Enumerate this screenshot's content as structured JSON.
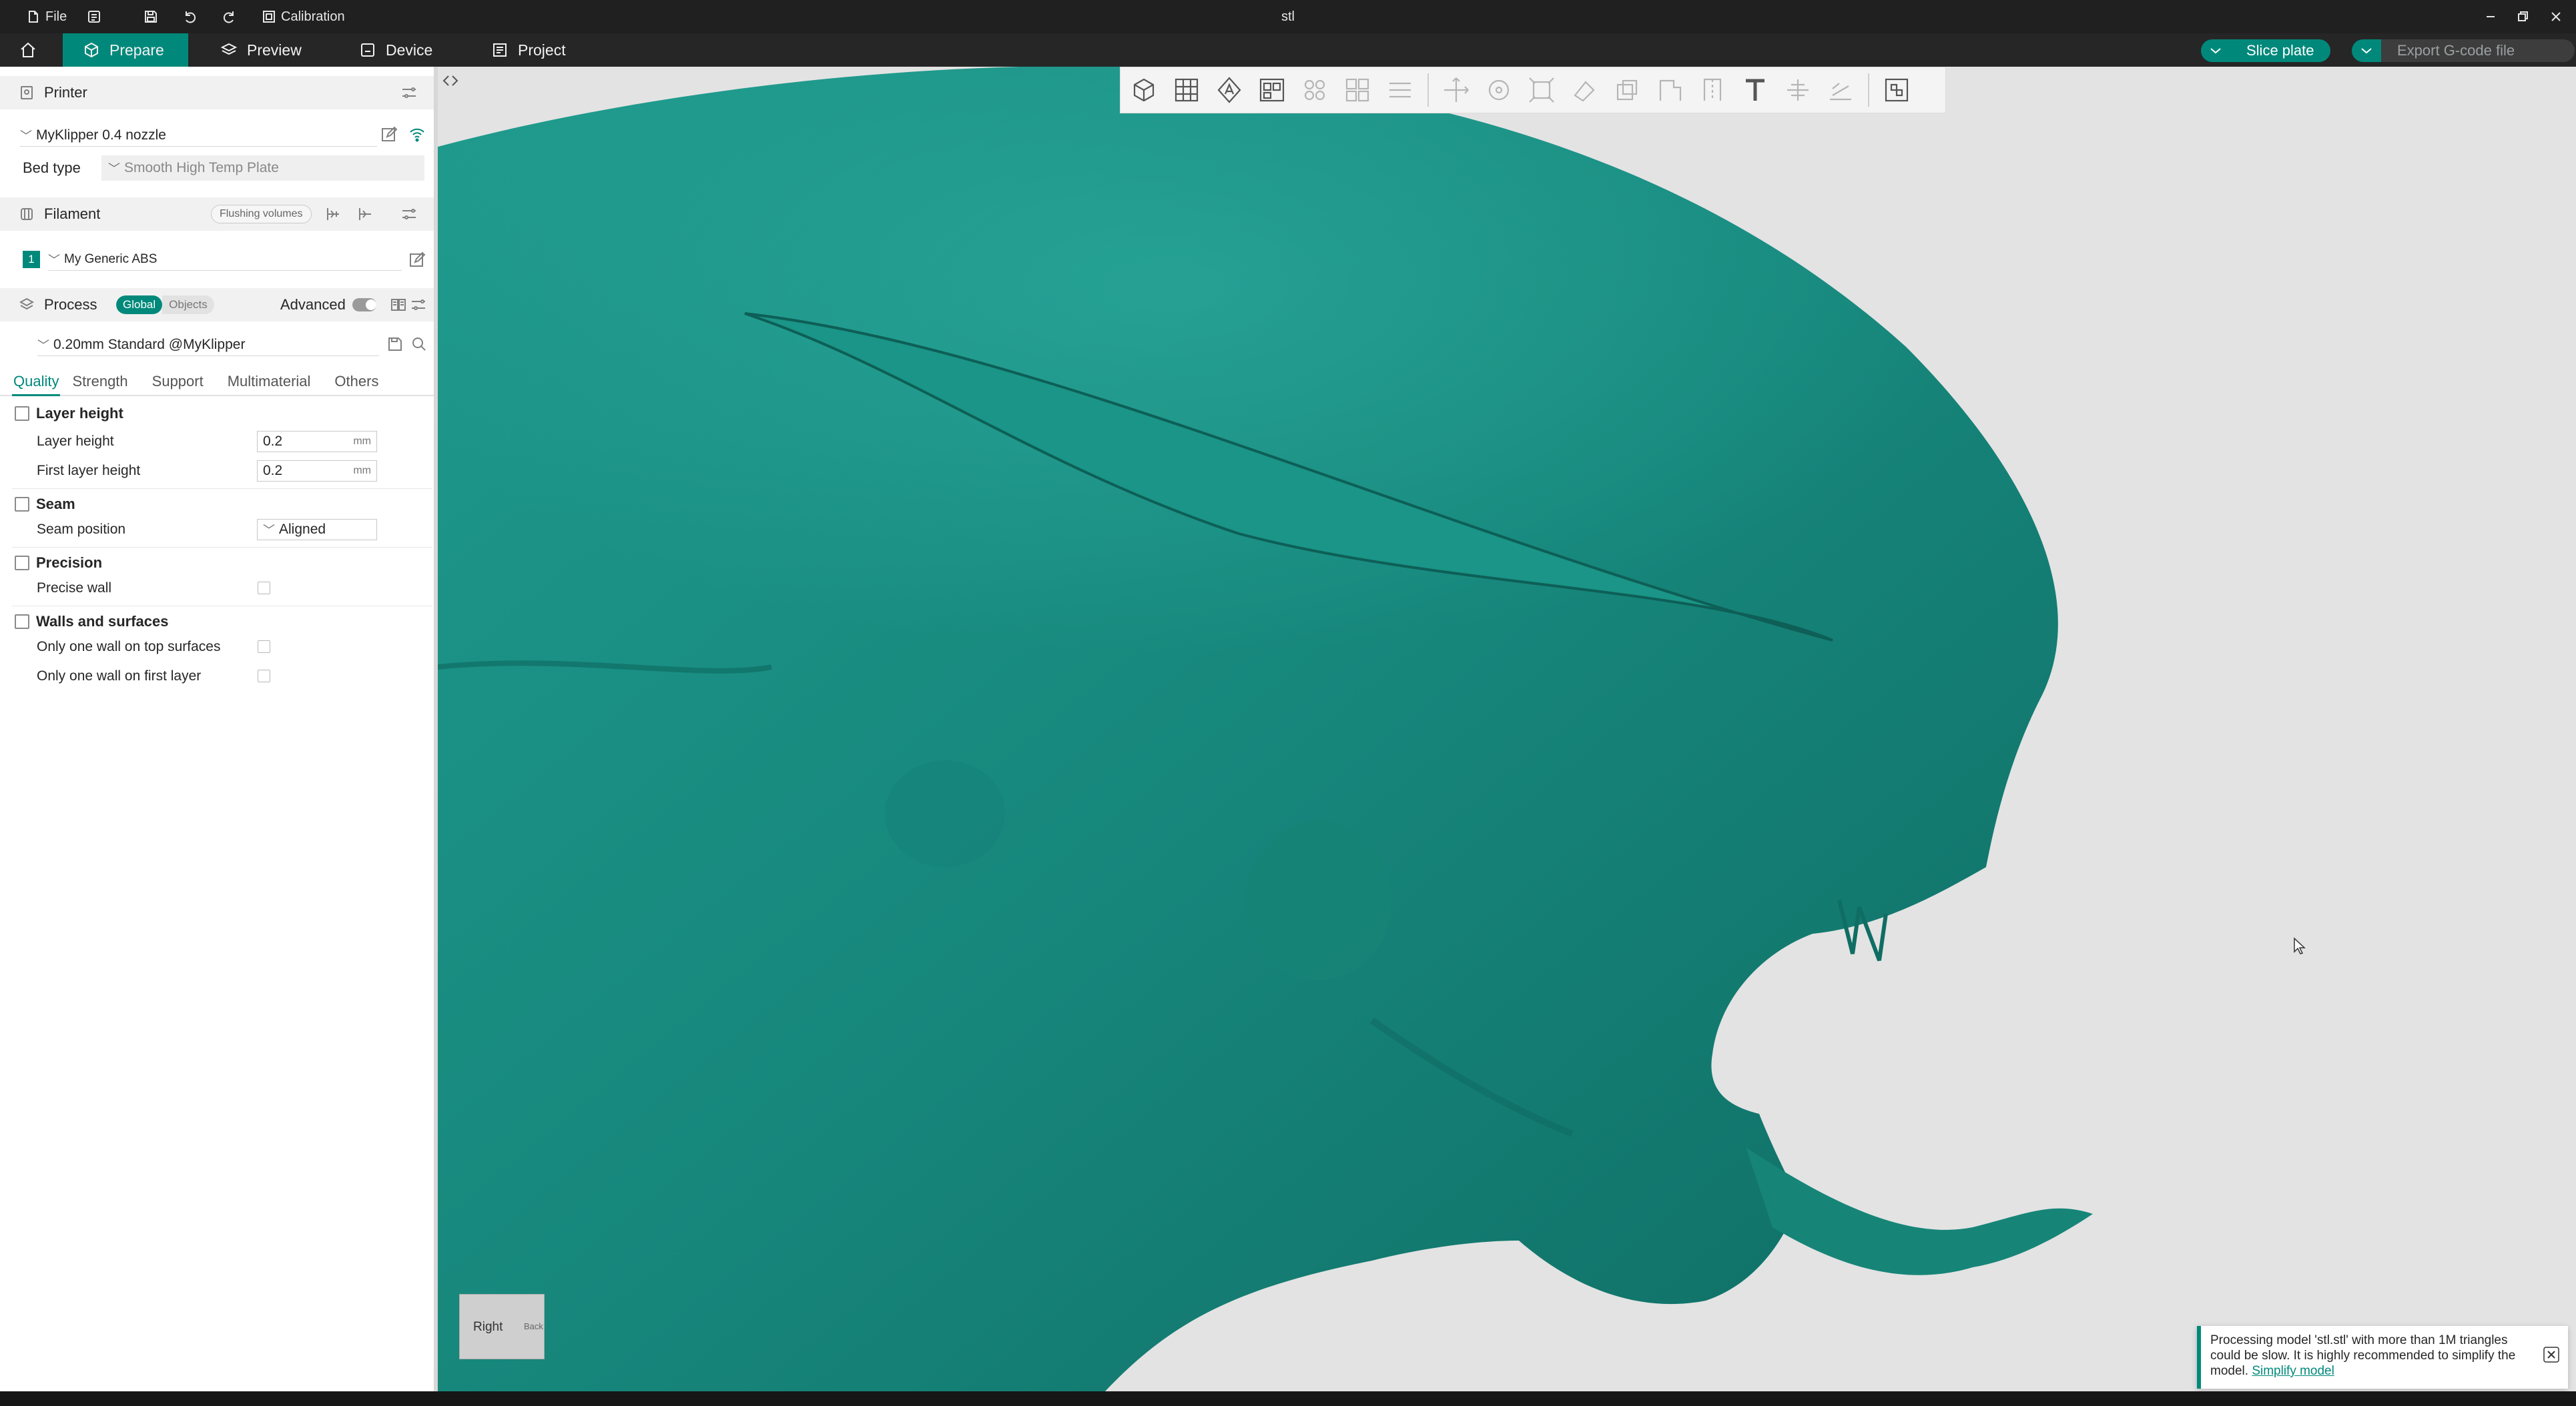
{
  "titlebar": {
    "file_label": "File",
    "calibration_label": "Calibration",
    "window_title": "stl"
  },
  "tabs": {
    "prepare": "Prepare",
    "preview": "Preview",
    "device": "Device",
    "project": "Project"
  },
  "actions": {
    "slice": "Slice plate",
    "export": "Export G-code file"
  },
  "printer": {
    "section": "Printer",
    "name": "MyKlipper 0.4 nozzle",
    "bed_type_label": "Bed type",
    "bed_type_value": "Smooth High Temp Plate"
  },
  "filament": {
    "section": "Filament",
    "flushing": "Flushing volumes",
    "slot_number": "1",
    "slot_name": "My Generic ABS"
  },
  "process": {
    "section": "Process",
    "scope_global": "Global",
    "scope_objects": "Objects",
    "advanced": "Advanced",
    "preset": "0.20mm Standard @MyKlipper",
    "tabs": [
      "Quality",
      "Strength",
      "Support",
      "Multimaterial",
      "Others"
    ]
  },
  "quality": {
    "layer_height_group": "Layer height",
    "layer_height_label": "Layer height",
    "layer_height_value": "0.2",
    "first_layer_label": "First layer height",
    "first_layer_value": "0.2",
    "unit": "mm",
    "seam_group": "Seam",
    "seam_position_label": "Seam position",
    "seam_position_value": "Aligned",
    "precision_group": "Precision",
    "precise_wall_label": "Precise wall",
    "walls_group": "Walls and surfaces",
    "one_wall_top_label": "Only one wall on top surfaces",
    "one_wall_first_label": "Only one wall on first layer"
  },
  "viewport": {
    "navcube_face": "Right",
    "navcube_side": "Back",
    "notice_text": "Processing model 'stl.stl' with more than 1M triangles could be slow. It is highly recommended to simplify the model.",
    "notice_link": "Simplify model"
  },
  "colors": {
    "accent": "#00897b",
    "model": "#17877c"
  }
}
